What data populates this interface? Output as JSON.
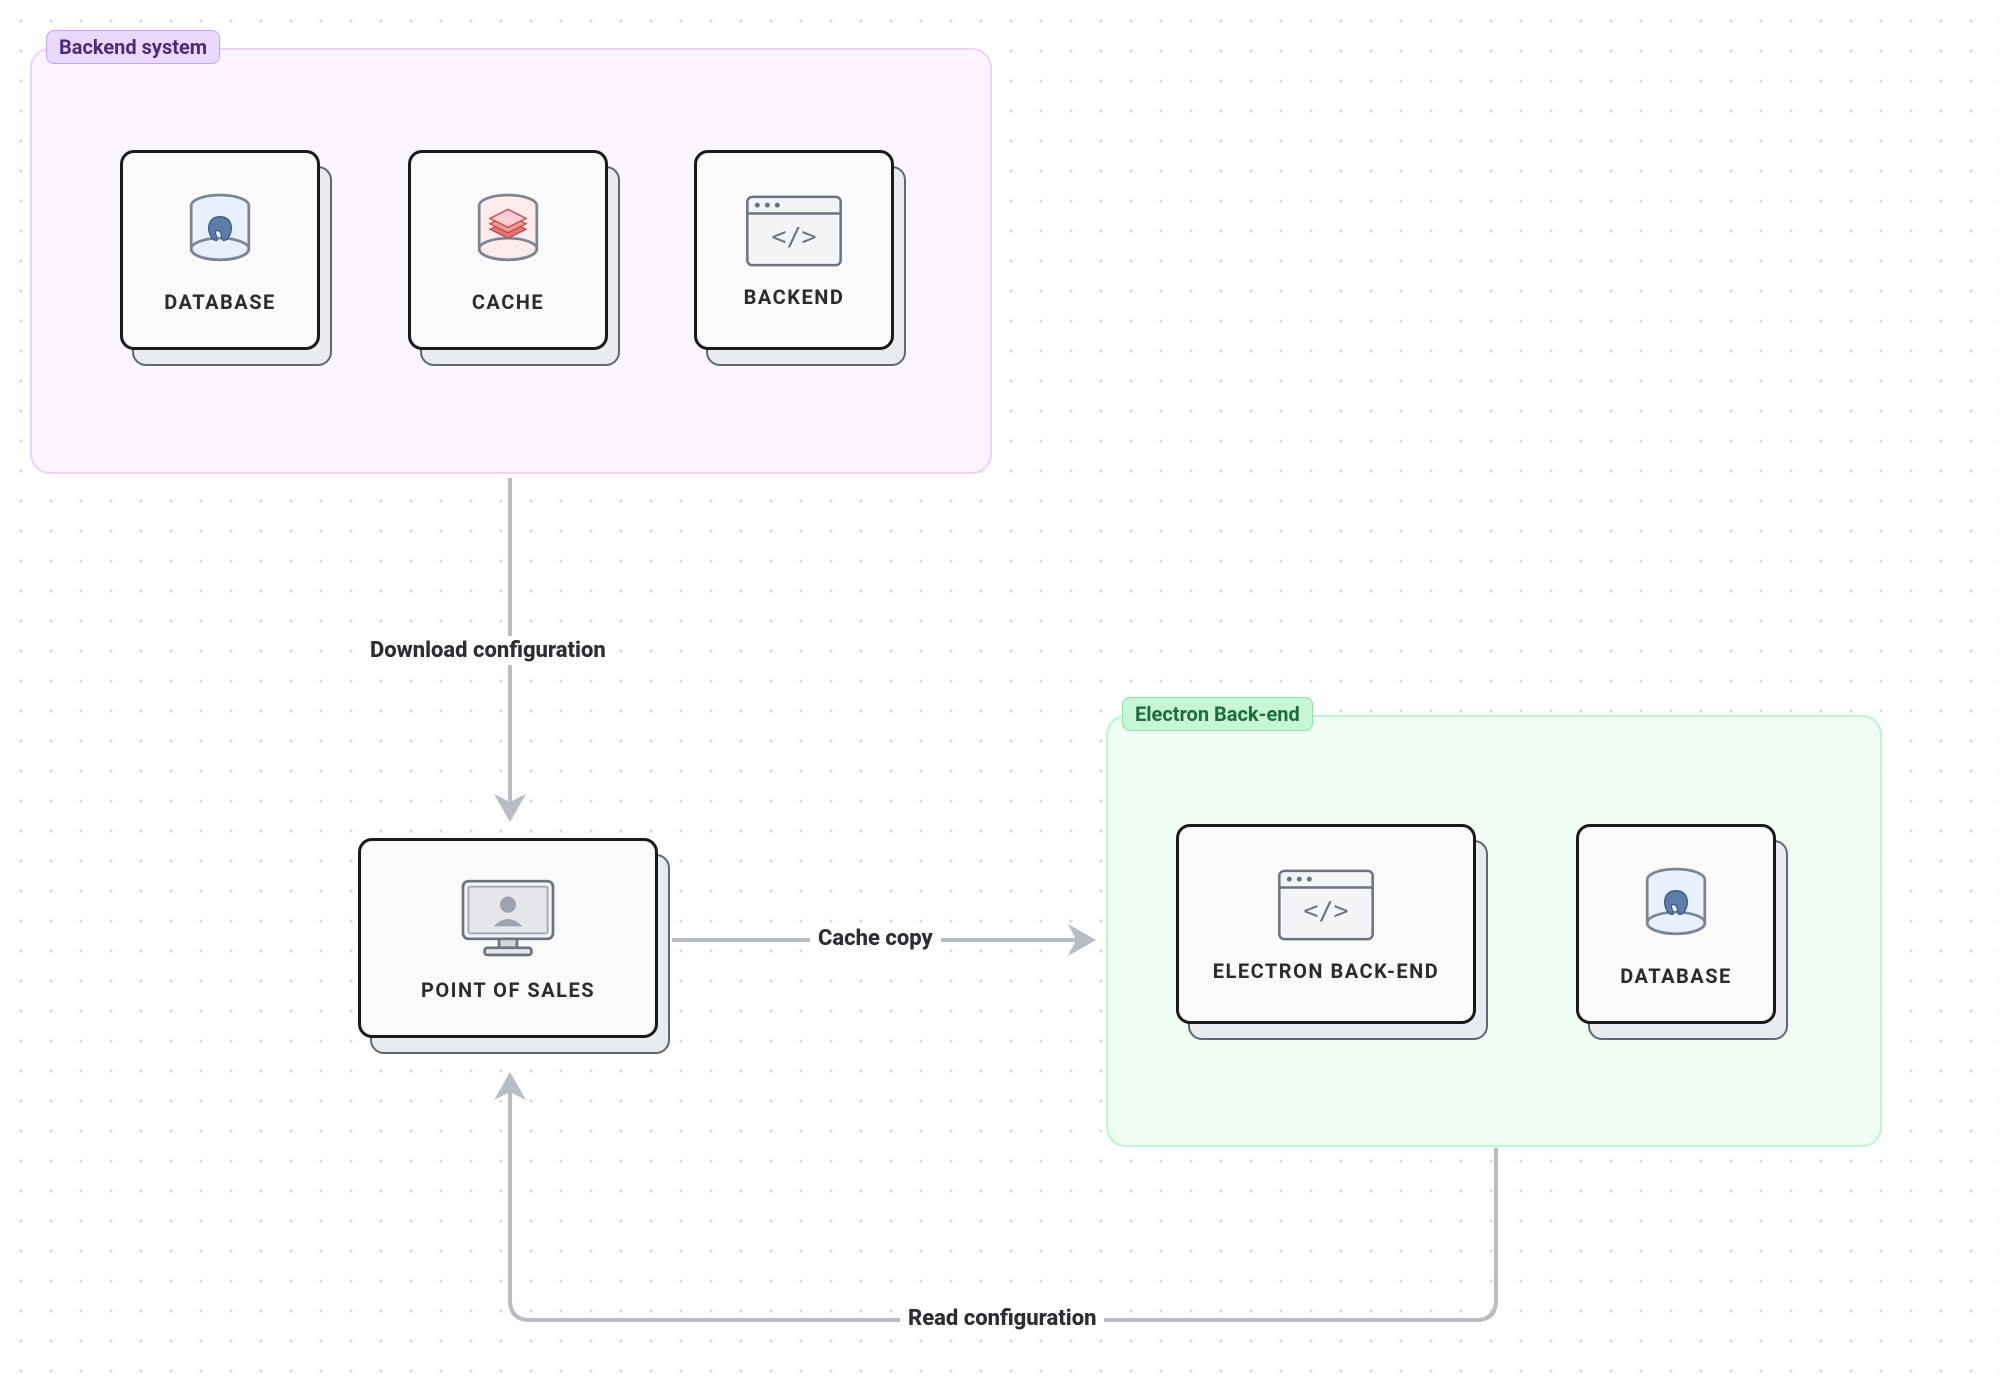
{
  "groups": {
    "backend_system": {
      "label": "Backend system"
    },
    "electron_backend": {
      "label": "Electron Back-end"
    }
  },
  "nodes": {
    "database1": {
      "label": "DATABASE",
      "icon": "database-postgres"
    },
    "cache": {
      "label": "CACHE",
      "icon": "cache-redis"
    },
    "backend": {
      "label": "BACKEND",
      "icon": "code-window"
    },
    "pos": {
      "label": "POINT OF SALES",
      "icon": "monitor-user"
    },
    "electron": {
      "label": "ELECTRON BACK-END",
      "icon": "code-window"
    },
    "database2": {
      "label": "DATABASE",
      "icon": "database-postgres"
    }
  },
  "edges": {
    "download_config": {
      "label": "Download configuration"
    },
    "cache_copy": {
      "label": "Cache copy"
    },
    "read_config": {
      "label": "Read configuration"
    }
  }
}
